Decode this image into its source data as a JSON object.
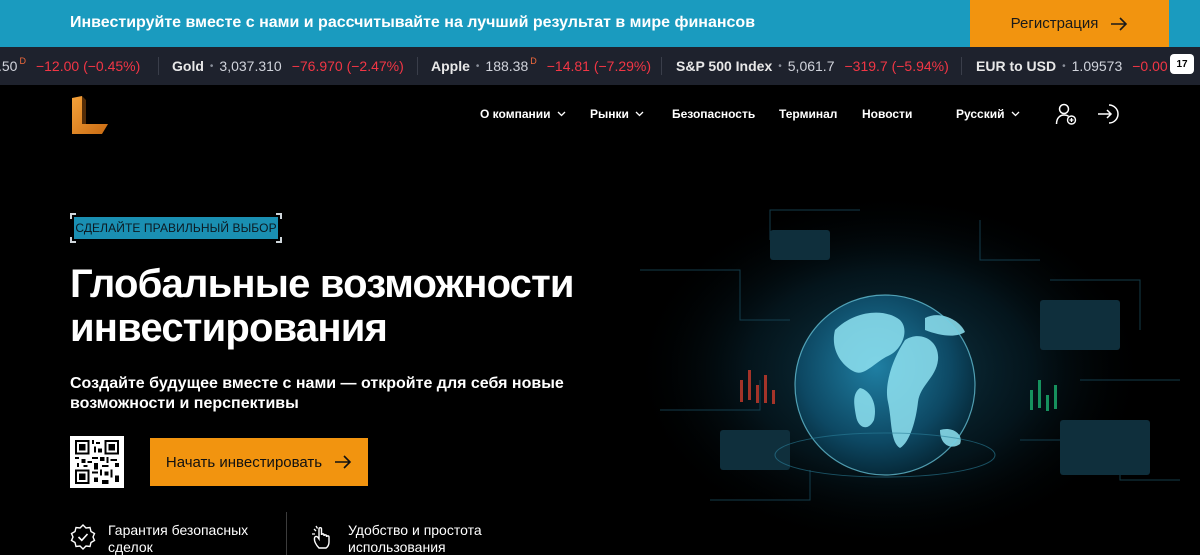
{
  "promo": {
    "text": "Инвестируйте вместе с нами и рассчитывайте на лучший результат в мире финансов",
    "button_label": "Регистрация"
  },
  "ticker": [
    {
      "name": "",
      "price": ".50",
      "sup": "D",
      "change": "−12.00 (−0.45%)"
    },
    {
      "name": "Gold",
      "price": "3,037.310",
      "sup": "",
      "change": "−76.970 (−2.47%)"
    },
    {
      "name": "Apple",
      "price": "188.38",
      "sup": "D",
      "change": "−14.81 (−7.29%)"
    },
    {
      "name": "S&P 500 Index",
      "price": "5,061.7",
      "sup": "",
      "change": "−319.7 (−5.94%)"
    },
    {
      "name": "EUR to USD",
      "price": "1.09573",
      "sup": "",
      "change": "−0.00"
    }
  ],
  "tv_badge": "17",
  "nav": {
    "items": [
      "О компании",
      "Рынки",
      "Безопасность",
      "Терминал",
      "Новости"
    ],
    "language": "Русский",
    "icons": [
      "user-add-icon",
      "login-icon"
    ]
  },
  "hero": {
    "badge": "СДЕЛАЙТЕ ПРАВИЛЬНЫЙ ВЫБОР",
    "title": "Глобальные возможности инвестирования",
    "subtitle": "Создайте будущее вместе с нами — откройте для себя новые возможности и перспективы",
    "cta_label": "Начать инвестировать"
  },
  "features": [
    {
      "icon": "shield-check-icon",
      "text": "Гарантия безопасных сделок"
    },
    {
      "icon": "pointer-hand-icon",
      "text": "Удобство и простота использования"
    }
  ],
  "colors": {
    "accent": "#f2940f",
    "promo_bg": "#1a9bbf",
    "ticker_bg": "#1e222d",
    "negative": "#f23645",
    "background": "#000000"
  }
}
